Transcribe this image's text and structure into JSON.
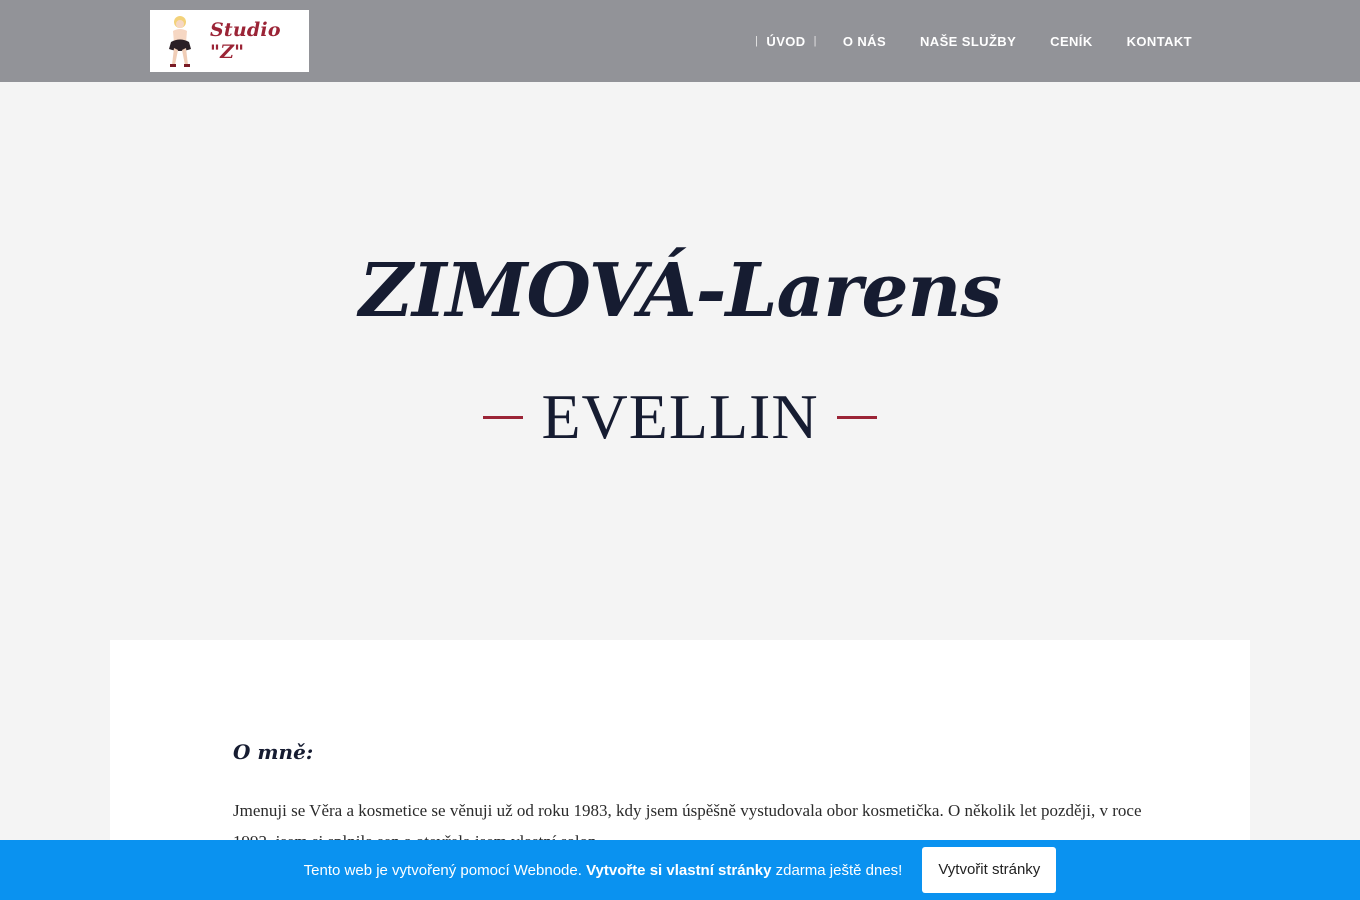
{
  "logo": {
    "text": "Studio \"Z\"",
    "icon": "pinup-figure-icon"
  },
  "nav": {
    "items": [
      {
        "label": "ÚVOD"
      },
      {
        "label": "O NÁS"
      },
      {
        "label": "NAŠE SLUŽBY"
      },
      {
        "label": "CENÍK"
      },
      {
        "label": "KONTAKT"
      }
    ],
    "separator": "|"
  },
  "hero": {
    "title": "ZIMOVÁ-Larens",
    "subtitle": "EVELLIN"
  },
  "content": {
    "heading": "O mně:",
    "paragraph": "Jmenuji se Věra a kosmetice se věnuji už od roku 1983, kdy jsem úspěšně vystudovala obor kosmetička. O několik let později, v roce 1992, jsem si splnila sen a otevřela jsem vlastní salon."
  },
  "banner": {
    "text_before": "Tento web je vytvořený pomocí Webnode.",
    "text_bold": "Vytvořte si vlastní stránky",
    "text_after": "zdarma ještě dnes!",
    "button_label": "Vytvořit stránky"
  },
  "colors": {
    "header_bg": "#929398",
    "accent": "#9b2436",
    "banner_bg": "#0a92f0",
    "page_bg": "#f4f4f4"
  }
}
